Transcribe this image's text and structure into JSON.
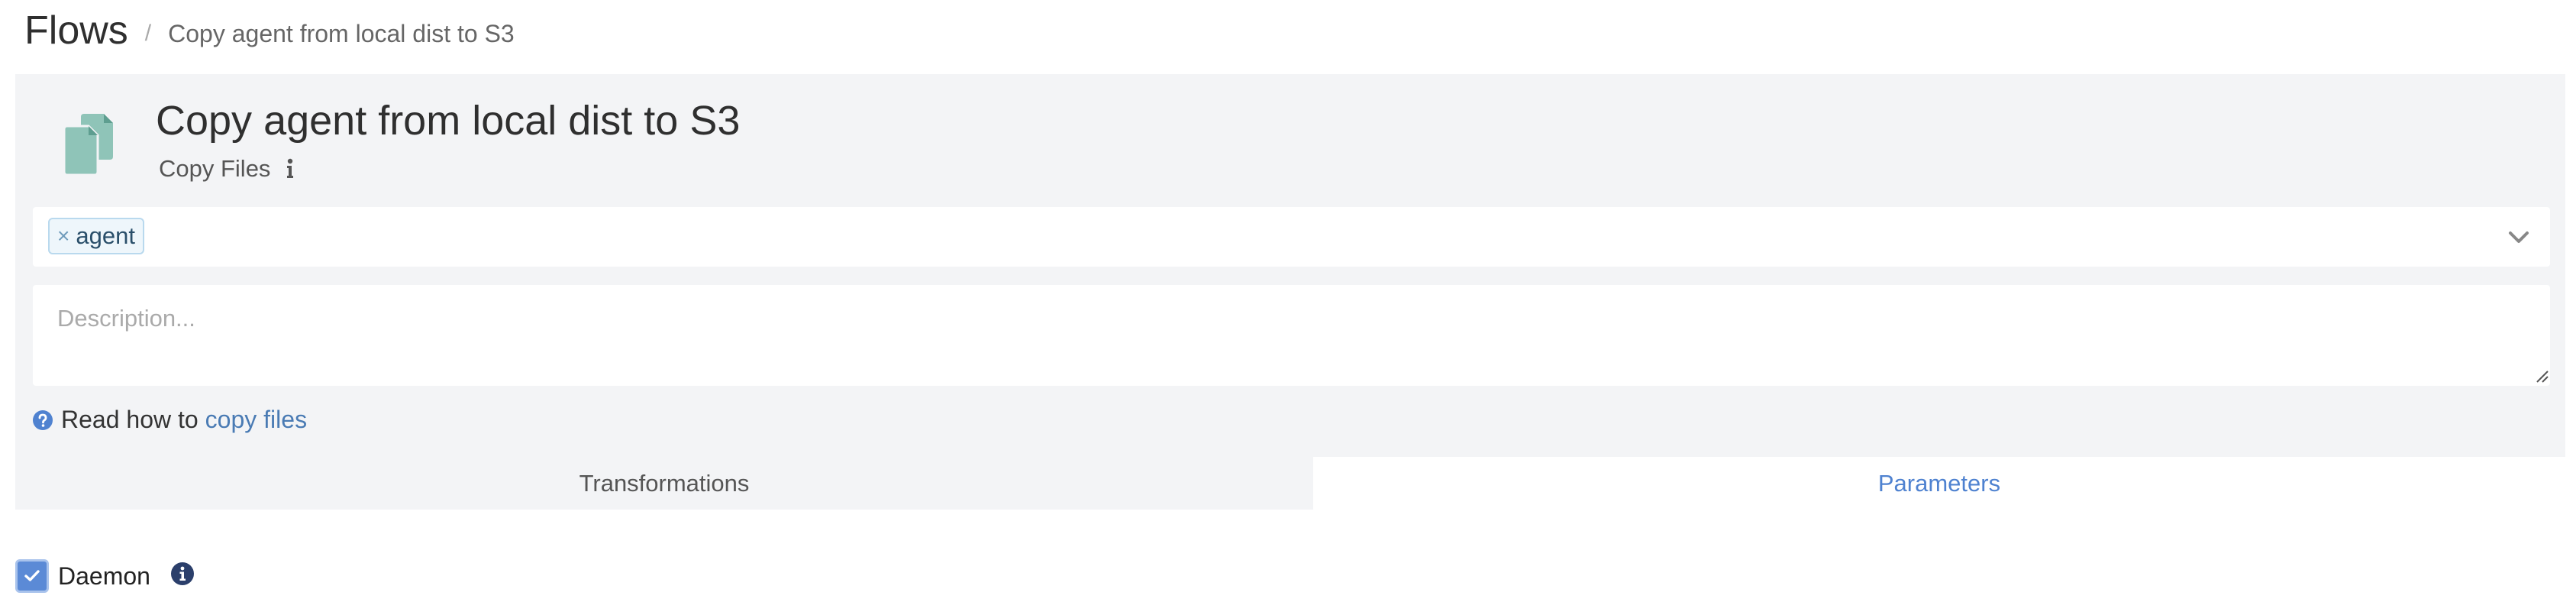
{
  "breadcrumb": {
    "root": "Flows",
    "separator": "/",
    "current": "Copy agent from local dist to S3"
  },
  "flow": {
    "title": "Copy agent from local dist to S3",
    "type": "Copy Files",
    "icon": "copy-files-icon"
  },
  "tags": {
    "items": [
      {
        "label": "agent",
        "remove": "×"
      }
    ]
  },
  "description": {
    "placeholder": "Description...",
    "value": ""
  },
  "help": {
    "prefix": "Read how to",
    "link": "copy files"
  },
  "tabs": [
    {
      "label": "Transformations",
      "active": false
    },
    {
      "label": "Parameters",
      "active": true
    }
  ],
  "parameters": {
    "daemon": {
      "label": "Daemon",
      "checked": true
    }
  },
  "colors": {
    "accent": "#4f82d0",
    "panel_bg": "#f3f4f6",
    "link": "#4a7bb4",
    "icon_teal": "#8fc4b8"
  }
}
